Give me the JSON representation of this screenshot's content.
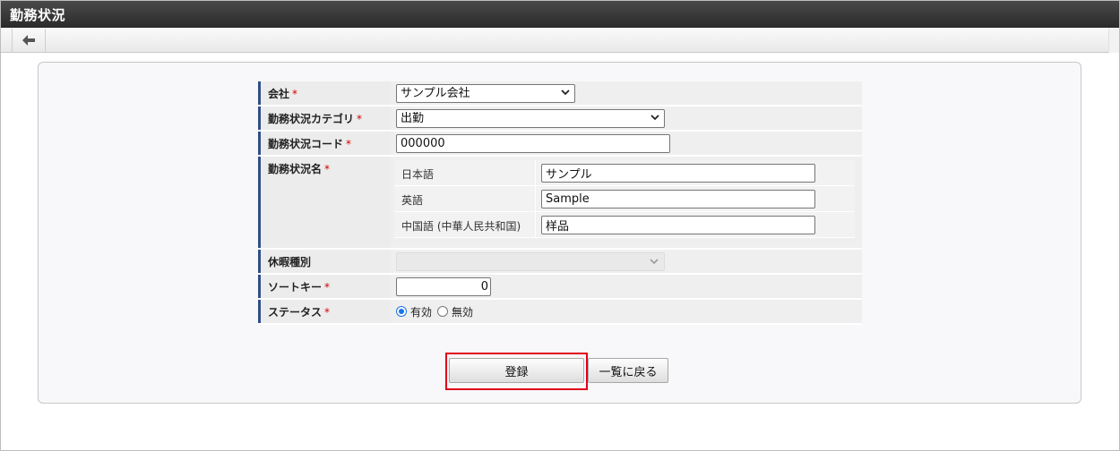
{
  "window": {
    "title": "勤務状況"
  },
  "toolbar": {
    "back_icon": "arrow-left-icon"
  },
  "form": {
    "company": {
      "label": "会社",
      "required": "*",
      "value": "サンプル会社"
    },
    "category": {
      "label": "勤務状況カテゴリ",
      "required": "*",
      "value": "出勤"
    },
    "code": {
      "label": "勤務状況コード",
      "required": "*",
      "value": "000000"
    },
    "name": {
      "label": "勤務状況名",
      "required": "*",
      "langs": [
        {
          "label": "日本語",
          "value": "サンプル"
        },
        {
          "label": "英語",
          "value": "Sample"
        },
        {
          "label": "中国語 (中華人民共和国)",
          "value": "样品"
        }
      ]
    },
    "leave_type": {
      "label": "休暇種別",
      "value": ""
    },
    "sort_key": {
      "label": "ソートキー",
      "required": "*",
      "value": "0"
    },
    "status": {
      "label": "ステータス",
      "required": "*",
      "options": [
        "有効",
        "無効"
      ],
      "selected": "有効"
    }
  },
  "buttons": {
    "register": "登録",
    "back_to_list": "一覧に戻る"
  },
  "colors": {
    "titlebar": "#2a2a2a",
    "label_accent": "#2f4f86",
    "required": "#d40000",
    "highlight": "#e0001a"
  }
}
